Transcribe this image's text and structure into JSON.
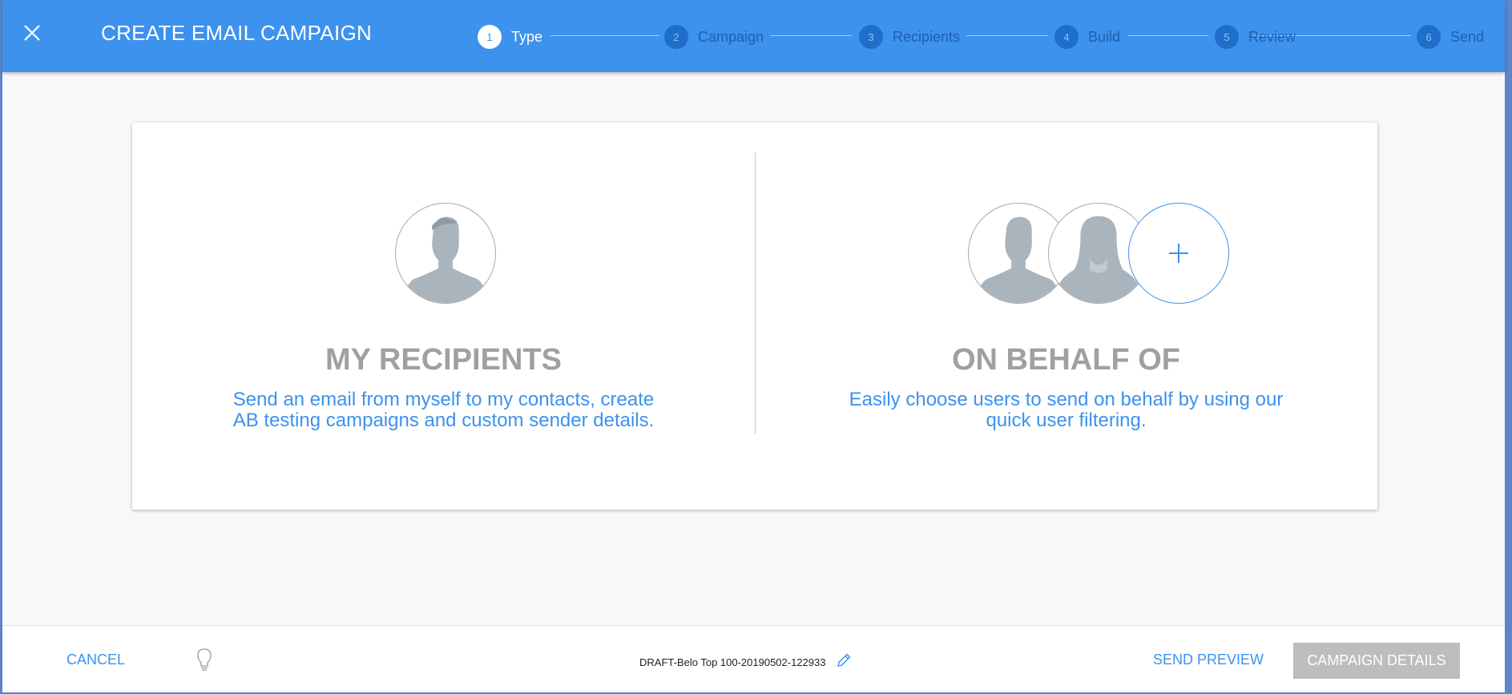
{
  "header": {
    "title": "CREATE EMAIL CAMPAIGN",
    "close_icon": "close-icon",
    "accent_color": "#3d92ed",
    "steps": [
      {
        "number": "1",
        "label": "Type",
        "active": true
      },
      {
        "number": "2",
        "label": "Campaign",
        "active": false
      },
      {
        "number": "3",
        "label": "Recipients",
        "active": false
      },
      {
        "number": "4",
        "label": "Build",
        "active": false
      },
      {
        "number": "5",
        "label": "Review",
        "active": false
      },
      {
        "number": "6",
        "label": "Send",
        "active": false
      }
    ]
  },
  "options": {
    "my_recipients": {
      "title": "MY RECIPIENTS",
      "desc_line1": "Send an email from myself to my contacts, create",
      "desc_line2": "AB testing campaigns and custom sender details.",
      "icon": "male-user-avatar-icon"
    },
    "on_behalf_of": {
      "title": "ON BEHALF OF",
      "desc_line1": "Easily choose users to send on behalf by using our",
      "desc_line2": "quick user filtering.",
      "icons": [
        "male-user-avatar-icon",
        "female-user-avatar-icon",
        "plus-icon"
      ]
    }
  },
  "footer": {
    "cancel_label": "CANCEL",
    "bulb_icon": "lightbulb-icon",
    "draft_name": "DRAFT-Belo Top 100-20190502-122933",
    "pencil_icon": "pencil-icon",
    "send_preview_label": "SEND PREVIEW",
    "campaign_details_label": "CAMPAIGN DETAILS"
  }
}
